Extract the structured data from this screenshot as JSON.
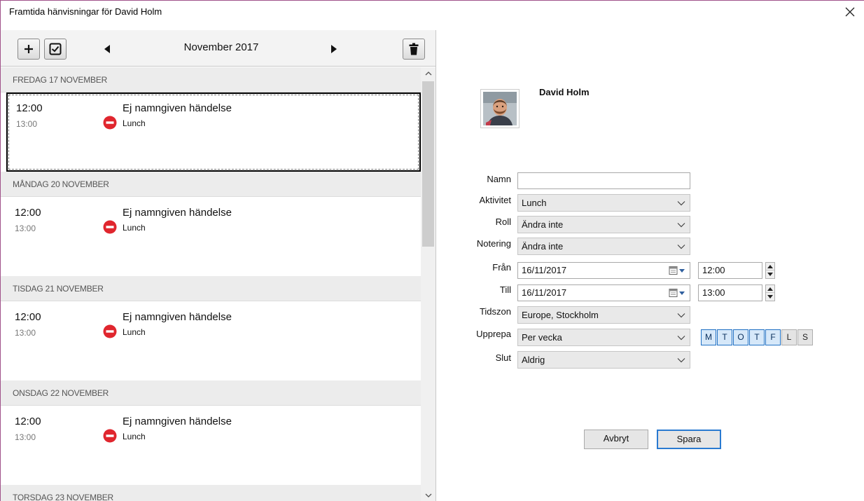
{
  "window": {
    "title": "Framtida hänvisningar för David Holm",
    "close_icon": "close-icon"
  },
  "toolbar": {
    "add_icon": "plus-icon",
    "select_icon": "checkbox-icon",
    "prev_icon": "triangle-left-icon",
    "next_icon": "triangle-right-icon",
    "delete_icon": "trash-icon",
    "month": "November 2017"
  },
  "days": [
    {
      "header": "FREDAG 17 NOVEMBER",
      "start": "12:00",
      "end": "13:00",
      "title": "Ej namngiven händelse",
      "activity": "Lunch",
      "selected": true
    },
    {
      "header": "MÅNDAG 20 NOVEMBER",
      "start": "12:00",
      "end": "13:00",
      "title": "Ej namngiven händelse",
      "activity": "Lunch"
    },
    {
      "header": "TISDAG 21 NOVEMBER",
      "start": "12:00",
      "end": "13:00",
      "title": "Ej namngiven händelse",
      "activity": "Lunch"
    },
    {
      "header": "ONSDAG 22 NOVEMBER",
      "start": "12:00",
      "end": "13:00",
      "title": "Ej namngiven händelse",
      "activity": "Lunch"
    },
    {
      "header": "TORSDAG 23 NOVEMBER"
    }
  ],
  "form": {
    "person_name": "David Holm",
    "labels": {
      "name": "Namn",
      "activity": "Aktivitet",
      "role": "Roll",
      "note": "Notering",
      "from": "Från",
      "to": "Till",
      "timezone": "Tidszon",
      "repeat": "Upprepa",
      "end": "Slut"
    },
    "values": {
      "name": "",
      "activity": "Lunch",
      "role": "Ändra inte",
      "note": "Ändra inte",
      "from_date": "16/11/2017",
      "from_time": "12:00",
      "to_date": "16/11/2017",
      "to_time": "13:00",
      "timezone": "Europe, Stockholm",
      "repeat": "Per vecka",
      "end": "Aldrig"
    },
    "weekdays": [
      {
        "label": "M",
        "active": true
      },
      {
        "label": "T",
        "active": true
      },
      {
        "label": "O",
        "active": true
      },
      {
        "label": "T",
        "active": true
      },
      {
        "label": "F",
        "active": true
      },
      {
        "label": "L",
        "active": false
      },
      {
        "label": "S",
        "active": false
      }
    ],
    "cancel_label": "Avbryt",
    "save_label": "Spara"
  },
  "colors": {
    "activity_icon": "#e0262e",
    "active_day_border": "#1f70c4",
    "save_border": "#2a7ad1"
  }
}
